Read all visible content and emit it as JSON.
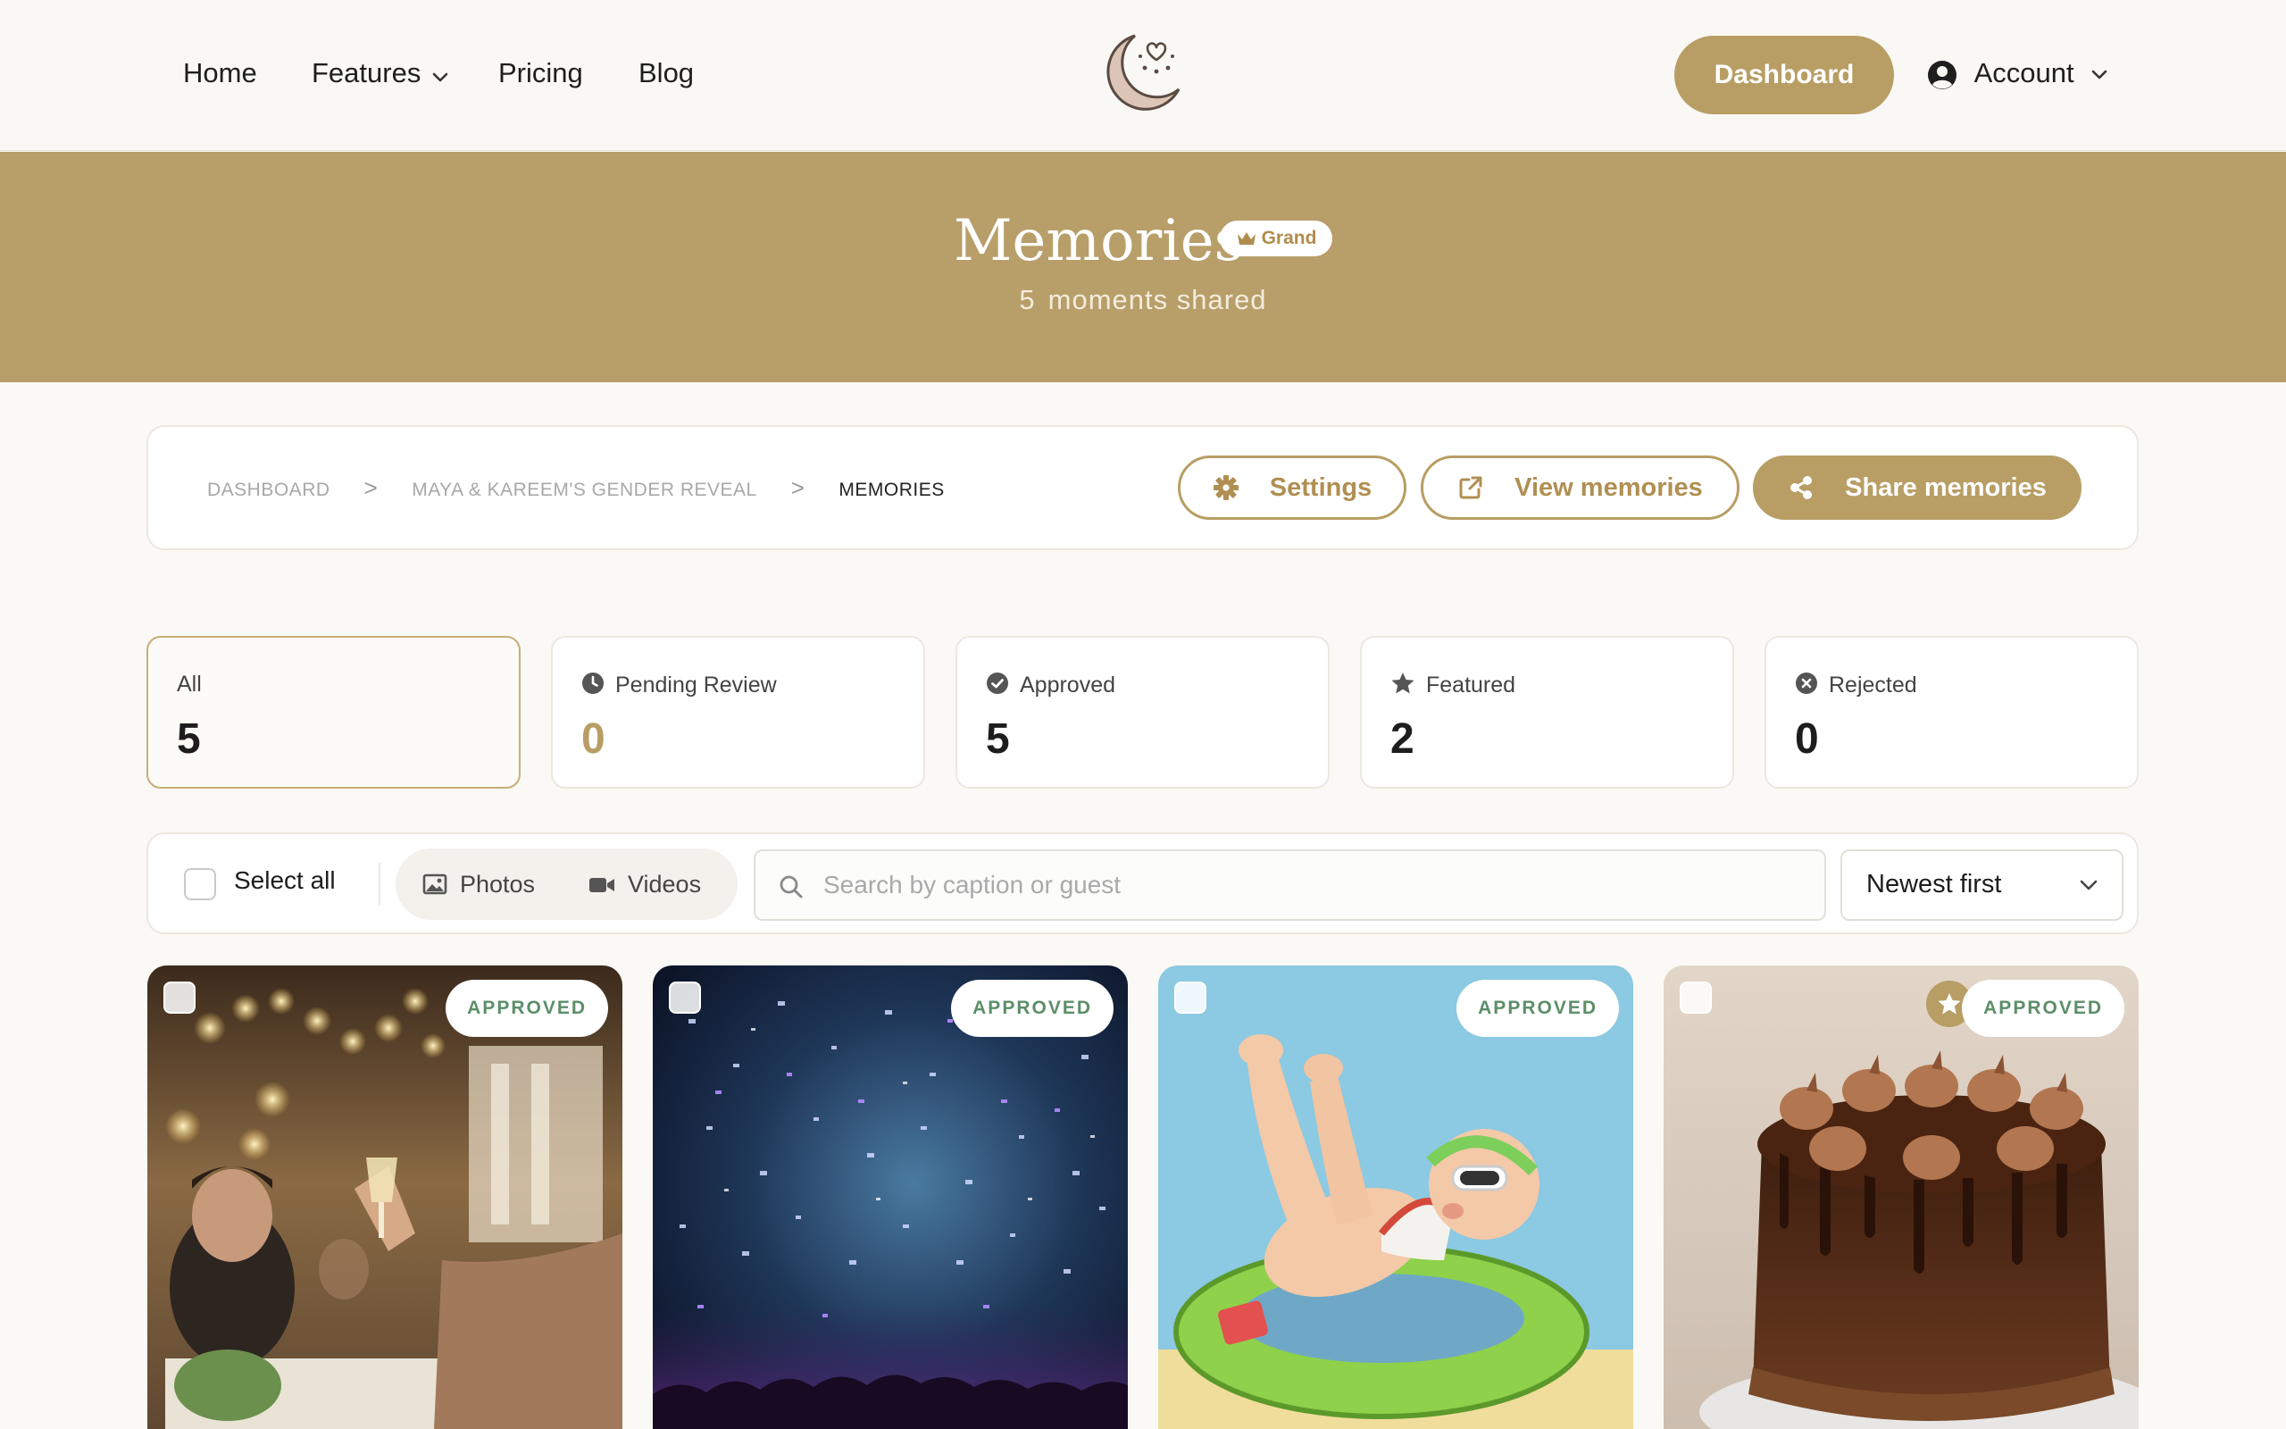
{
  "nav": {
    "links": [
      "Home",
      "Features",
      "Pricing",
      "Blog"
    ],
    "dashboard_label": "Dashboard",
    "account_label": "Account",
    "logo_icon": "moon-heart-logo"
  },
  "hero": {
    "title": "Memories",
    "tier": "Grand",
    "count": "5",
    "count_suffix": "moments shared"
  },
  "breadcrumb": {
    "items": [
      "Dashboard",
      "Maya & Kareem's Gender Reveal",
      "Memories"
    ],
    "separator": ">"
  },
  "actions": {
    "settings": "Settings",
    "view": "View memories",
    "share": "Share memories"
  },
  "stats": [
    {
      "label": "All",
      "value": "5",
      "icon": "",
      "active": true
    },
    {
      "label": "Pending Review",
      "value": "0",
      "icon": "clock-icon"
    },
    {
      "label": "Approved",
      "value": "5",
      "icon": "check-circle-icon"
    },
    {
      "label": "Featured",
      "value": "2",
      "icon": "star-icon"
    },
    {
      "label": "Rejected",
      "value": "0",
      "icon": "x-circle-icon"
    }
  ],
  "filters": {
    "select_all": "Select all",
    "photos": "Photos",
    "videos": "Videos",
    "search_placeholder": "Search by caption or guest",
    "sort_value": "Newest first"
  },
  "media": [
    {
      "status": "APPROVED",
      "featured": false,
      "subject": "celebration-toast"
    },
    {
      "status": "APPROVED",
      "featured": false,
      "subject": "confetti-concert"
    },
    {
      "status": "APPROVED",
      "featured": false,
      "subject": "baby-pool-float"
    },
    {
      "status": "APPROVED",
      "featured": true,
      "subject": "chocolate-cake"
    }
  ],
  "colors": {
    "accent": "#b89e64",
    "hero_bg": "#b89e69",
    "approved_text": "#5c8e68",
    "pending_value": "#b89e64"
  }
}
